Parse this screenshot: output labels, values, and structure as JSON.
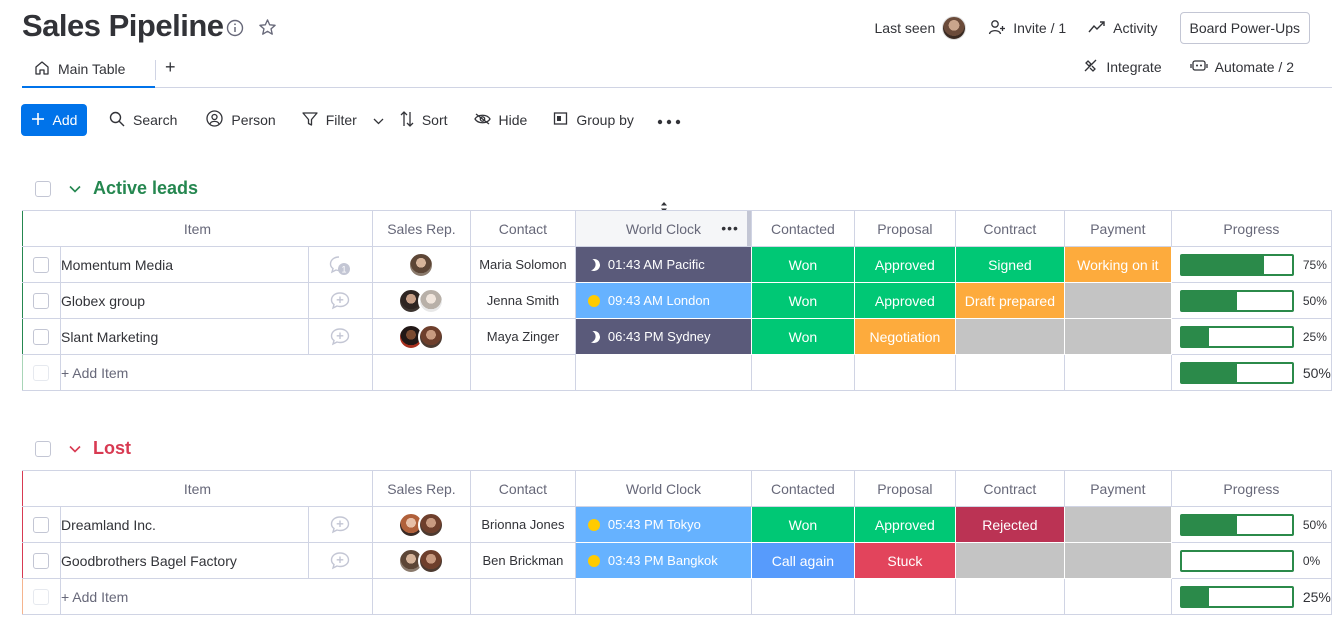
{
  "board": {
    "title": "Sales Pipeline",
    "header": {
      "last_seen_label": "Last seen",
      "invite_label": "Invite / 1",
      "activity_label": "Activity",
      "power_ups_label": "Board Power-Ups"
    },
    "tabs": {
      "main_table_label": "Main Table",
      "add_tab_label": "+",
      "integrate_label": "Integrate",
      "automate_label": "Automate / 2"
    },
    "toolbar": {
      "add_label": "Add",
      "search_label": "Search",
      "person_label": "Person",
      "filter_label": "Filter",
      "sort_label": "Sort",
      "hide_label": "Hide",
      "group_by_label": "Group by"
    }
  },
  "columns": {
    "item": "Item",
    "sales_rep": "Sales Rep.",
    "contact": "Contact",
    "world_clock": "World Clock",
    "contacted": "Contacted",
    "proposal": "Proposal",
    "contract": "Contract",
    "payment": "Payment",
    "progress": "Progress"
  },
  "colors": {
    "active_group": "#258750",
    "lost_group": "#d83a52",
    "won": "#00c875",
    "approved": "#00c875",
    "signed": "#00c875",
    "working_on_it": "#fdab3d",
    "draft_prepared": "#fdab3d",
    "negotiation": "#fdab3d",
    "rejected": "#bb3354",
    "call_again": "#579bfc",
    "stuck": "#e2445c",
    "night_clock": "#5a5a7a",
    "day_clock": "#66b2ff",
    "empty_status": "#c4c4c4",
    "primary": "#0073ea"
  },
  "groups": {
    "active": {
      "name": "Active leads",
      "add_item_label": "+ Add Item",
      "summary_progress": "50%",
      "summary_value": 0.5,
      "rows": [
        {
          "item": "Momentum Media",
          "updates_count": "1",
          "contact": "Maria Solomon",
          "clock": "01:43 AM Pacific",
          "contacted": "Won",
          "proposal": "Approved",
          "contract": "Signed",
          "payment": "Working on it",
          "progress": "75%",
          "progress_value": 0.75
        },
        {
          "item": "Globex group",
          "contact": "Jenna Smith",
          "clock": "09:43 AM London",
          "contacted": "Won",
          "proposal": "Approved",
          "contract": "Draft prepared",
          "payment": "",
          "progress": "50%",
          "progress_value": 0.5
        },
        {
          "item": "Slant Marketing",
          "contact": "Maya Zinger",
          "clock": "06:43 PM Sydney",
          "contacted": "Won",
          "proposal": "Negotiation",
          "contract": "",
          "payment": "",
          "progress": "25%",
          "progress_value": 0.25
        }
      ]
    },
    "lost": {
      "name": "Lost",
      "add_item_label": "+ Add Item",
      "summary_progress": "25%",
      "summary_value": 0.25,
      "rows": [
        {
          "item": "Dreamland Inc.",
          "contact": "Brionna Jones",
          "clock": "05:43 PM Tokyo",
          "contacted": "Won",
          "proposal": "Approved",
          "contract": "Rejected",
          "payment": "",
          "progress": "50%",
          "progress_value": 0.5
        },
        {
          "item": "Goodbrothers Bagel Factory",
          "contact": "Ben Brickman",
          "clock": "03:43 PM Bangkok",
          "contacted": "Call again",
          "proposal": "Stuck",
          "contract": "",
          "payment": "",
          "progress": "0%",
          "progress_value": 0
        }
      ]
    }
  }
}
